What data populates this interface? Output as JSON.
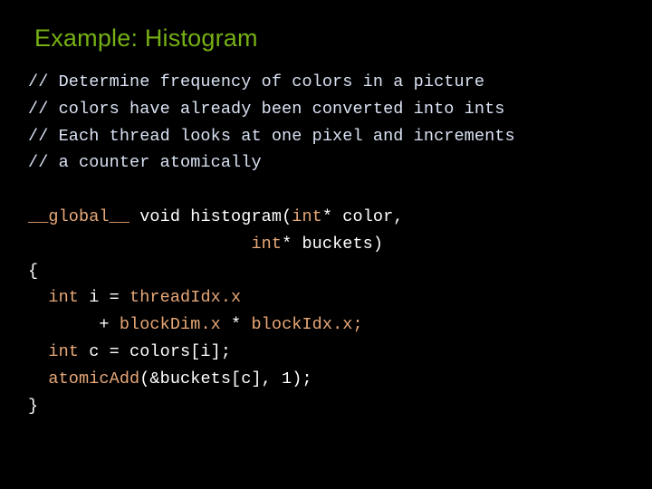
{
  "slide": {
    "title": "Example: Histogram",
    "title_color": "#76B014",
    "background_color": "#000000",
    "comment_color": "#D9E2F3",
    "keyword_color": "#E8A878",
    "plain_color": "#FFFFFF"
  },
  "code": {
    "language": "CUDA C",
    "lines": [
      {
        "id": "l1",
        "segments": [
          {
            "text": "// Determine frequency of colors in a picture",
            "style": "comment"
          }
        ]
      },
      {
        "id": "l2",
        "segments": [
          {
            "text": "// colors have already been converted into ints",
            "style": "comment"
          }
        ]
      },
      {
        "id": "l3",
        "segments": [
          {
            "text": "// Each thread looks at one pixel and increments",
            "style": "comment"
          }
        ]
      },
      {
        "id": "l4",
        "segments": [
          {
            "text": "// a counter atomically",
            "style": "comment"
          }
        ]
      },
      {
        "id": "l5",
        "segments": [
          {
            "text": "",
            "style": "plain"
          }
        ]
      },
      {
        "id": "l6",
        "segments": [
          {
            "text": "__global__",
            "style": "kw"
          },
          {
            "text": " void ",
            "style": "plain"
          },
          {
            "text": "histogram(",
            "style": "plain"
          },
          {
            "text": "int",
            "style": "kw"
          },
          {
            "text": "* color,",
            "style": "plain"
          }
        ]
      },
      {
        "id": "l7",
        "segments": [
          {
            "text": "                      ",
            "style": "plain"
          },
          {
            "text": "int",
            "style": "kw"
          },
          {
            "text": "* buckets)",
            "style": "plain"
          }
        ]
      },
      {
        "id": "l8",
        "segments": [
          {
            "text": "{",
            "style": "plain"
          }
        ]
      },
      {
        "id": "l9",
        "segments": [
          {
            "text": "  ",
            "style": "plain"
          },
          {
            "text": "int",
            "style": "kw"
          },
          {
            "text": " i = ",
            "style": "plain"
          },
          {
            "text": "threadIdx.x",
            "style": "ident"
          }
        ]
      },
      {
        "id": "l10",
        "segments": [
          {
            "text": "       + ",
            "style": "plain"
          },
          {
            "text": "blockDim.x",
            "style": "ident"
          },
          {
            "text": " * ",
            "style": "plain"
          },
          {
            "text": "blockIdx.x;",
            "style": "ident"
          }
        ]
      },
      {
        "id": "l11",
        "segments": [
          {
            "text": "  ",
            "style": "plain"
          },
          {
            "text": "int",
            "style": "kw"
          },
          {
            "text": " c = colors[i];",
            "style": "plain"
          }
        ]
      },
      {
        "id": "l12",
        "segments": [
          {
            "text": "  ",
            "style": "plain"
          },
          {
            "text": "atomicAdd",
            "style": "ident"
          },
          {
            "text": "(&buckets[c], 1);",
            "style": "plain"
          }
        ]
      },
      {
        "id": "l13",
        "segments": [
          {
            "text": "}",
            "style": "plain"
          }
        ]
      }
    ]
  }
}
